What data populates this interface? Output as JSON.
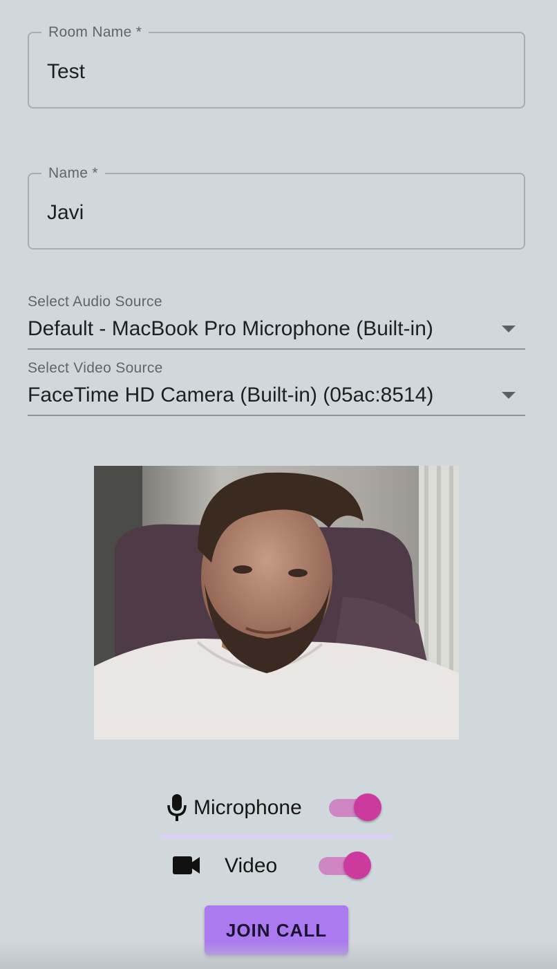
{
  "room_field": {
    "label": "Room Name *",
    "value": "Test"
  },
  "name_field": {
    "label": "Name *",
    "value": "Javi"
  },
  "audio_select": {
    "label": "Select Audio Source",
    "value": "Default - MacBook Pro Microphone (Built-in)",
    "icon": "chevron-down-icon"
  },
  "video_select": {
    "label": "Select Video Source",
    "value": "FaceTime HD Camera (Built-in) (05ac:8514)",
    "icon": "chevron-down-icon"
  },
  "preview": {
    "icon": "camera-preview"
  },
  "toggles": {
    "microphone": {
      "label": "Microphone",
      "icon": "microphone-icon",
      "on": true
    },
    "video": {
      "label": "Video",
      "icon": "videocam-icon",
      "on": true
    }
  },
  "join_button": {
    "label": "JOIN CALL"
  },
  "colors": {
    "background": "#d1d8dc",
    "switch_thumb": "#cd3a9e",
    "switch_track": "#cf86c2",
    "button": "#ab7af0",
    "mic_level": "#dccff4"
  }
}
